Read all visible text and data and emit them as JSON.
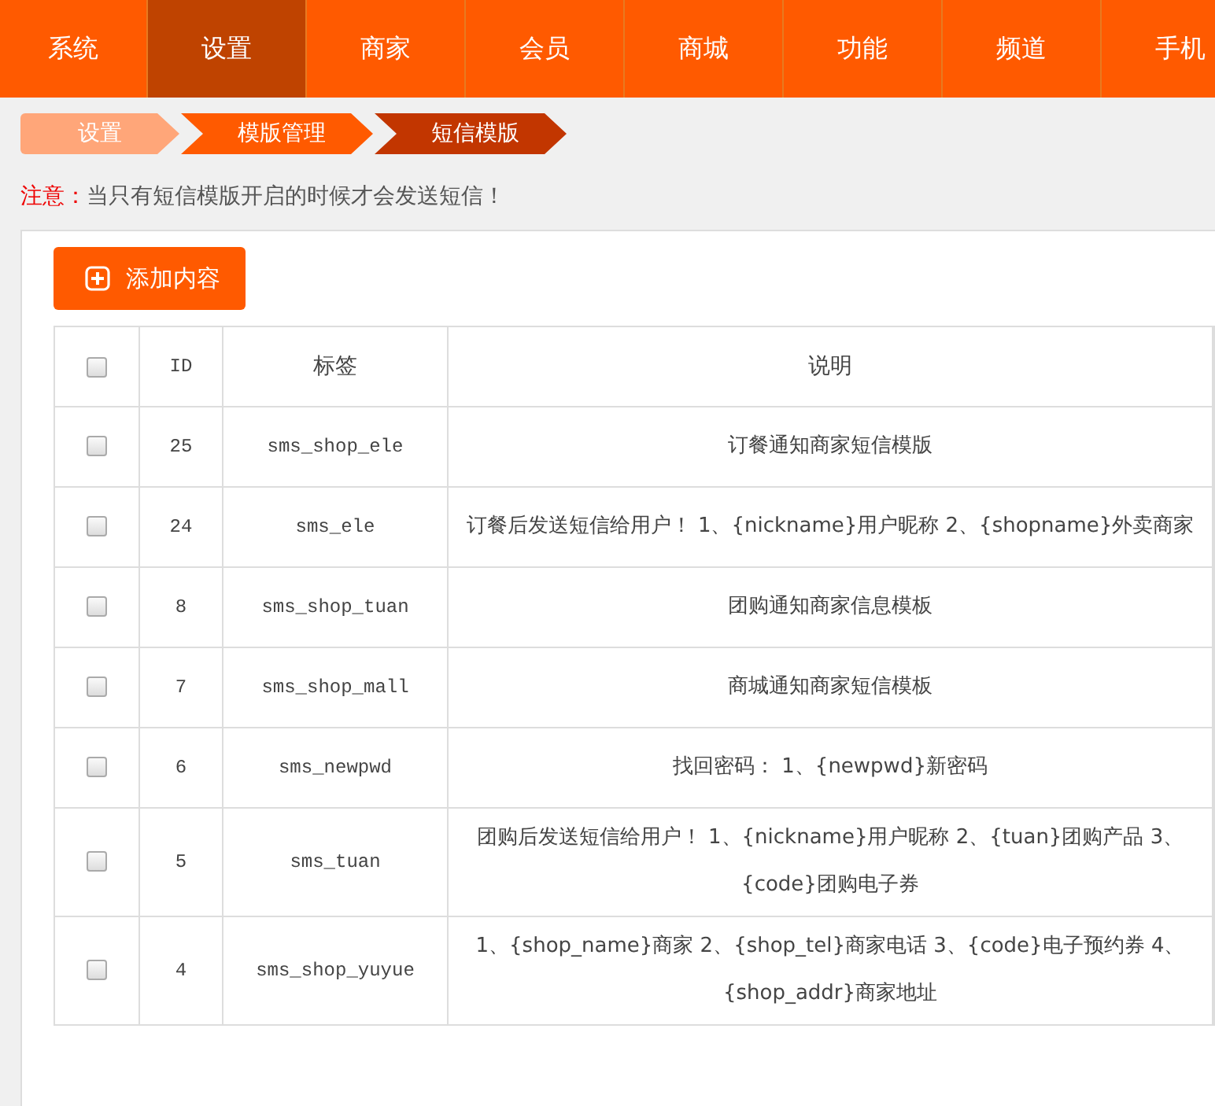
{
  "nav": [
    {
      "label": "系统",
      "selected": false
    },
    {
      "label": "设置",
      "selected": true
    },
    {
      "label": "商家",
      "selected": false
    },
    {
      "label": "会员",
      "selected": false
    },
    {
      "label": "商城",
      "selected": false
    },
    {
      "label": "功能",
      "selected": false
    },
    {
      "label": "频道",
      "selected": false
    },
    {
      "label": "手机",
      "selected": false
    }
  ],
  "breadcrumb": [
    {
      "label": "设置",
      "color": "#ffa679"
    },
    {
      "label": "模版管理",
      "color": "#ff5a00"
    },
    {
      "label": "短信模版",
      "color": "#c23600"
    }
  ],
  "notice": {
    "label": "注意：",
    "text": "当只有短信模版开启的时候才会发送短信！"
  },
  "add_button": "添加内容",
  "table": {
    "select_all_checked": false,
    "columns": [
      "ID",
      "标签",
      "说明"
    ],
    "rows": [
      {
        "checked": false,
        "id": "25",
        "tag": "sms_shop_ele",
        "desc": "订餐通知商家短信模版"
      },
      {
        "checked": false,
        "id": "24",
        "tag": "sms_ele",
        "desc": "订餐后发送短信给用户！ 1、{nickname}用户昵称 2、{shopname}外卖商家"
      },
      {
        "checked": false,
        "id": "8",
        "tag": "sms_shop_tuan",
        "desc": "团购通知商家信息模板"
      },
      {
        "checked": false,
        "id": "7",
        "tag": "sms_shop_mall",
        "desc": "商城通知商家短信模板"
      },
      {
        "checked": false,
        "id": "6",
        "tag": "sms_newpwd",
        "desc": "找回密码： 1、{newpwd}新密码"
      },
      {
        "checked": false,
        "id": "5",
        "tag": "sms_tuan",
        "desc": "团购后发送短信给用户！ 1、{nickname}用户昵称 2、{tuan}团购产品 3、{code}团购电子券"
      },
      {
        "checked": false,
        "id": "4",
        "tag": "sms_shop_yuyue",
        "desc": "1、{shop_name}商家 2、{shop_tel}商家电话 3、{code}电子预约券 4、{shop_addr}商家地址"
      }
    ]
  }
}
